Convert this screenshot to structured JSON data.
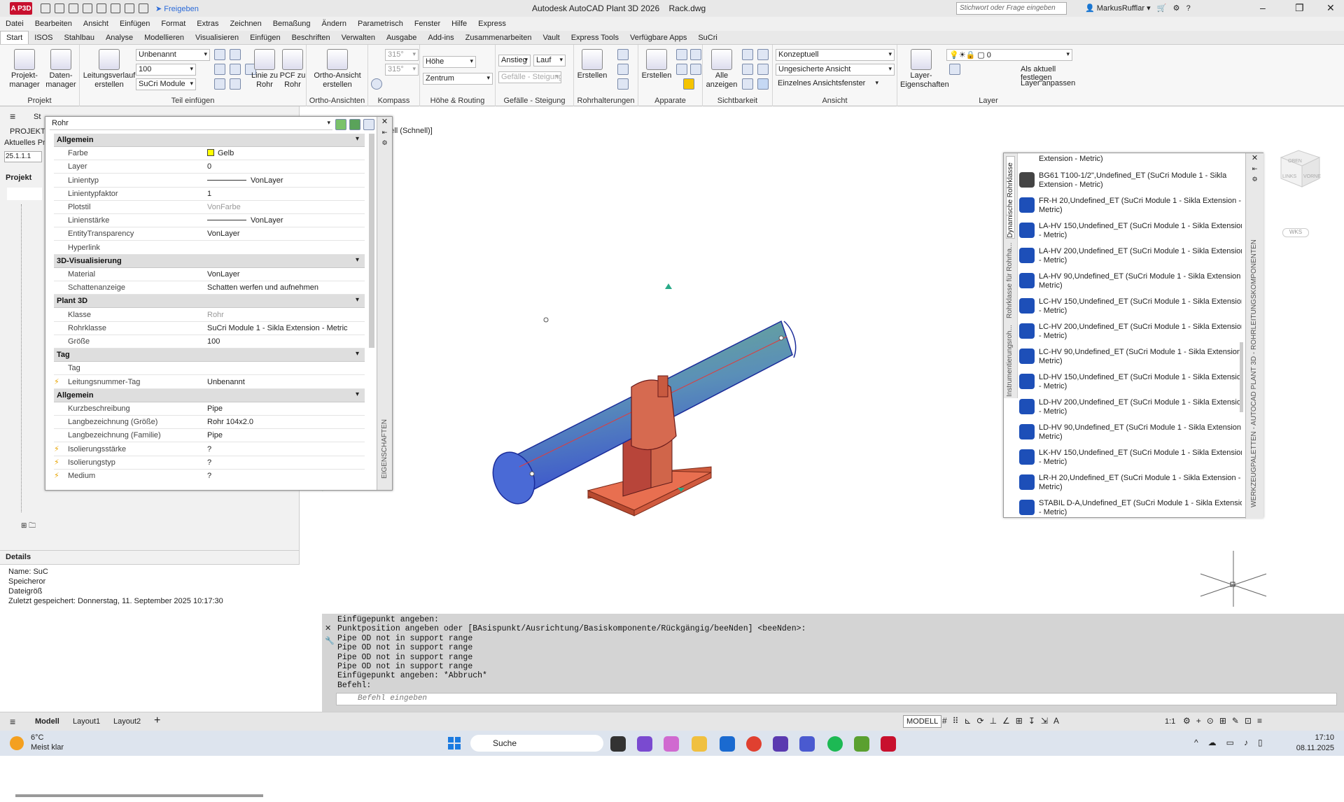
{
  "title": {
    "app": "Autodesk AutoCAD Plant 3D 2026",
    "file": "Rack.dwg",
    "search_placeholder": "Stichwort oder Frage eingeben",
    "user": "MarkusRufflar",
    "share": "Freigeben",
    "logo": "A P3D"
  },
  "menu": [
    "Datei",
    "Bearbeiten",
    "Ansicht",
    "Einfügen",
    "Format",
    "Extras",
    "Zeichnen",
    "Bemaßung",
    "Ändern",
    "Parametrisch",
    "Fenster",
    "Hilfe",
    "Express"
  ],
  "tabs": [
    "Start",
    "ISOS",
    "Stahlbau",
    "Analyse",
    "Modellieren",
    "Visualisieren",
    "Einfügen",
    "Beschriften",
    "Verwalten",
    "Ausgabe",
    "Add-ins",
    "Zusammenarbeiten",
    "Vault",
    "Express Tools",
    "Verfügbare Apps",
    "SuCri"
  ],
  "ribbon": {
    "projekt": {
      "label": "Projekt",
      "btn1": "Projekt-\nmanager",
      "btn2": "Daten-\nmanager"
    },
    "teil": {
      "label": "Teil einfügen",
      "btn_leitung": "Leitungsverlauf\nerstellen",
      "dd1": "Unbenannt",
      "dd2": "100",
      "dd3": "SuCri Module",
      "btn_linie": "Linie zu\nRohr",
      "btn_pcf": "PCF zu\nRohr"
    },
    "ortho": {
      "label": "Ortho-Ansichten",
      "btn": "Ortho-Ansicht\nerstellen"
    },
    "kompass": {
      "label": "Kompass",
      "a1": "315°",
      "a2": "315°"
    },
    "hoehe": {
      "label": "Höhe & Routing",
      "field": "Höhe",
      "dd": "Zentrum"
    },
    "gefaelle": {
      "label": "Gefälle - Steigung",
      "f1": "Anstieg",
      "f2": "Lauf",
      "dd": "Gefälle - Steigung"
    },
    "rohrhalt": {
      "label": "Rohrhalterungen",
      "btn": "Erstellen"
    },
    "apparate": {
      "label": "Apparate",
      "btn": "Erstellen"
    },
    "sicht": {
      "label": "Sichtbarkeit",
      "btn": "Alle\nanzeigen"
    },
    "ansicht": {
      "label": "Ansicht",
      "dd1": "Konzeptuell",
      "dd2": "Ungesicherte Ansicht",
      "dd3": "Einzelnes Ansichtsfenster"
    },
    "layer": {
      "label": "Layer",
      "btn": "Layer-\nEigenschaften",
      "dd": "0",
      "l1": "Als aktuell festlegen",
      "l2": "Layer anpassen"
    }
  },
  "left_panel": {
    "menu_icon": "≡",
    "tab": "St",
    "projekt": "PROJEKTM",
    "aktuell": "Aktuelles Pro",
    "version": "25.1.1.1",
    "projekt_hdr": "Projekt",
    "details_hdr": "Details",
    "name": "Name: SuC",
    "speicher": "Speicheror",
    "datei": "Dateigröß",
    "saved": "Zuletzt gespeichert: Donnerstag, 11. September 2025 10:17:30"
  },
  "properties": {
    "selector": "Rohr",
    "side_label": "EIGENSCHAFTEN",
    "rows": [
      {
        "k": "Allgemein",
        "sec": true
      },
      {
        "k": "Farbe",
        "v": "Gelb",
        "swatch": "#ffff00"
      },
      {
        "k": "Layer",
        "v": "0"
      },
      {
        "k": "Linientyp",
        "v": "VonLayer",
        "line": true
      },
      {
        "k": "Linientypfaktor",
        "v": "1"
      },
      {
        "k": "Plotstil",
        "v": "VonFarbe",
        "grey": true
      },
      {
        "k": "Linienstärke",
        "v": "VonLayer",
        "line": true
      },
      {
        "k": "EntityTransparency",
        "v": "VonLayer"
      },
      {
        "k": "Hyperlink",
        "v": ""
      },
      {
        "k": "3D-Visualisierung",
        "sec": true
      },
      {
        "k": "Material",
        "v": "VonLayer"
      },
      {
        "k": "Schattenanzeige",
        "v": "Schatten werfen und aufnehmen"
      },
      {
        "k": "Plant 3D",
        "sec": true
      },
      {
        "k": "Klasse",
        "v": "Rohr",
        "grey": true
      },
      {
        "k": "Rohrklasse",
        "v": "SuCri Module 1 - Sikla Extension - Metric"
      },
      {
        "k": "Größe",
        "v": "100"
      },
      {
        "k": "Tag",
        "sec": true
      },
      {
        "k": "Tag",
        "v": ""
      },
      {
        "k": "Leitungsnummer-Tag",
        "v": "Unbenannt",
        "bolt": true
      },
      {
        "k": "Allgemein",
        "sec": true
      },
      {
        "k": "Kurzbeschreibung",
        "v": "Pipe"
      },
      {
        "k": "Langbezeichnung (Größe)",
        "v": "Rohr 104x2.0"
      },
      {
        "k": "Langbezeichnung (Familie)",
        "v": "Pipe"
      },
      {
        "k": "Isolierungsstärke",
        "v": "?",
        "bolt": true
      },
      {
        "k": "Isolierungstyp",
        "v": "?",
        "bolt": true
      },
      {
        "k": "Medium",
        "v": "?",
        "bolt": true
      }
    ]
  },
  "viewport": {
    "label": "e Ansicht][Konzeptuell (Schnell)]",
    "wks": "WKS",
    "cube_top": "OBEN",
    "cube_left": "LINKS",
    "cube_front": "VORNE"
  },
  "palette": {
    "tabs": [
      "Dynamische Rohrklasse",
      "Rohrklasse für Rohrha...",
      "Instrumentierungsroh..."
    ],
    "side_title": "WERKZEUGPALETTEN - AUTOCAD PLANT 3D - ROHRLEITUNGSKOMPONENTEN",
    "top_partial": "Extension - Metric)",
    "items": [
      "BG61 T100-1/2\",Undefined_ET (SuCri Module 1 - Sikla Extension - Metric)",
      "FR-H 20,Undefined_ET (SuCri Module 1 - Sikla Extension - Metric)",
      "LA-HV 150,Undefined_ET (SuCri Module 1 - Sikla Extension - Metric)",
      "LA-HV 200,Undefined_ET (SuCri Module 1 - Sikla Extension - Metric)",
      "LA-HV 90,Undefined_ET (SuCri Module 1 - Sikla Extension - Metric)",
      "LC-HV 150,Undefined_ET (SuCri Module 1 - Sikla Extension - Metric)",
      "LC-HV 200,Undefined_ET (SuCri Module 1 - Sikla Extension - Metric)",
      "LC-HV 90,Undefined_ET (SuCri Module 1 - Sikla Extension - Metric)",
      "LD-HV 150,Undefined_ET (SuCri Module 1 - Sikla Extension - Metric)",
      "LD-HV 200,Undefined_ET (SuCri Module 1 - Sikla Extension - Metric)",
      "LD-HV 90,Undefined_ET (SuCri Module 1 - Sikla Extension - Metric)",
      "LK-HV 150,Undefined_ET (SuCri Module 1 - Sikla Extension - Metric)",
      "LR-H 20,Undefined_ET (SuCri Module 1 - Sikla Extension - Metric)",
      "STABIL D-A,Undefined_ET (SuCri Module 1 - Sikla Extension - Metric)"
    ]
  },
  "command": {
    "lines": "Einfügepunkt angeben:\nPunktposition angeben oder [BAsispunkt/Ausrichtung/Basiskomponente/Rückgängig/beeNden] <beeNden>:\nPipe OD not in support range\nPipe OD not in support range\nPipe OD not in support range\nPipe OD not in support range\nEinfügepunkt angeben: *Abbruch*\nBefehl:",
    "placeholder": "Befehl eingeben"
  },
  "status": {
    "model_tab": "Modell",
    "layout1": "Layout1",
    "layout2": "Layout2",
    "modell": "MODELL",
    "scale": "1:1"
  },
  "taskbar": {
    "temp": "6°C",
    "weather": "Meist klar",
    "search": "Suche",
    "time": "17:10",
    "date": "08.11.2025"
  }
}
